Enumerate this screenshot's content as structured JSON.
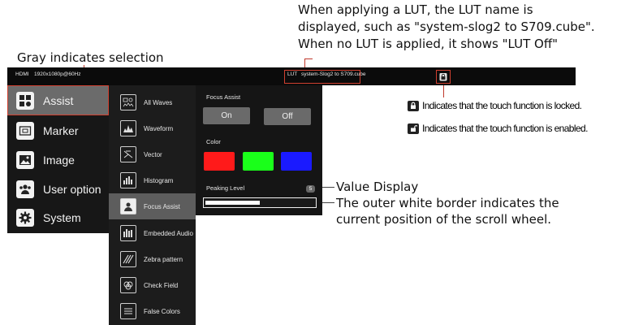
{
  "annotations": {
    "lut_note_line1": "When applying a LUT, the LUT name is",
    "lut_note_line2": "displayed, such as \"system-slog2 to S709.cube\".",
    "lut_note_line3": "When no LUT is applied, it shows \"LUT Off\"",
    "gray_selection": "Gray indicates selection",
    "value_display": "Value Display",
    "scroll_note_line1": "The outer white border indicates the",
    "scroll_note_line2": "current position of the scroll wheel.",
    "locked_legend": "Indicates that the touch function is locked.",
    "enabled_legend": "Indicates that the touch function is enabled."
  },
  "statusbar": {
    "input": "HDMI",
    "format": "1920x1080p@60Hz",
    "lut_label": "LUT",
    "lut_name": "system-Slog2  to S709.cube",
    "lock_icon": "lock-icon"
  },
  "left_menu": {
    "items": [
      {
        "label": "Assist",
        "icon": "assist-grid-icon",
        "selected": true
      },
      {
        "label": "Marker",
        "icon": "marker-icon",
        "selected": false
      },
      {
        "label": "Image",
        "icon": "image-icon",
        "selected": false
      },
      {
        "label": "User option",
        "icon": "users-icon",
        "selected": false
      },
      {
        "label": "System",
        "icon": "gear-icon",
        "selected": false
      }
    ]
  },
  "sub_menu": {
    "items": [
      {
        "label": "All Waves",
        "icon": "all-waves-icon",
        "selected": false
      },
      {
        "label": "Waveform",
        "icon": "waveform-icon",
        "selected": false
      },
      {
        "label": "Vector",
        "icon": "vector-icon",
        "selected": false
      },
      {
        "label": "Histogram",
        "icon": "histogram-icon",
        "selected": false
      },
      {
        "label": "Focus Assist",
        "icon": "focus-assist-icon",
        "selected": true
      },
      {
        "label": "Embedded Audio",
        "icon": "audio-meter-icon",
        "selected": false
      },
      {
        "label": "Zebra pattern",
        "icon": "zebra-icon",
        "selected": false
      },
      {
        "label": "Check Field",
        "icon": "check-field-icon",
        "selected": false
      },
      {
        "label": "False Colors",
        "icon": "false-colors-icon",
        "selected": false
      }
    ]
  },
  "panel": {
    "focus_assist_label": "Focus Assist",
    "on_label": "On",
    "off_label": "Off",
    "color_label": "Color",
    "colors": [
      "#ff1a1a",
      "#1aff1a",
      "#1a1aff"
    ],
    "peaking_label": "Peaking Level",
    "peaking_value": "5",
    "peaking_fraction": 0.5
  }
}
